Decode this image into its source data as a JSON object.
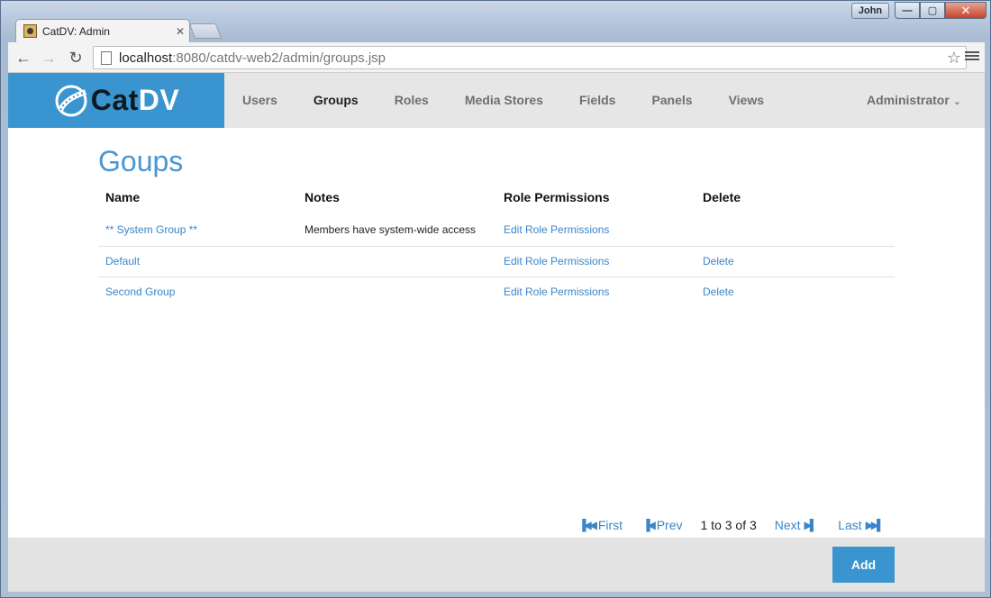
{
  "window": {
    "user": "John",
    "min_glyph": "—",
    "max_glyph": "▢",
    "close_glyph": "✕"
  },
  "tab": {
    "title": "CatDV: Admin",
    "close_glyph": "✕"
  },
  "toolbar": {
    "back_glyph": "←",
    "forward_glyph": "→",
    "reload_glyph": "↻",
    "url_host": "localhost",
    "url_path": ":8080/catdv-web2/admin/groups.jsp",
    "star_glyph": "☆"
  },
  "app": {
    "logo_cat": "Cat",
    "logo_dv": "DV",
    "nav": [
      {
        "label": "Users"
      },
      {
        "label": "Groups"
      },
      {
        "label": "Roles"
      },
      {
        "label": "Media Stores"
      },
      {
        "label": "Fields"
      },
      {
        "label": "Panels"
      },
      {
        "label": "Views"
      }
    ],
    "active_nav": "Groups",
    "admin_label": "Administrator",
    "admin_chevron": "⌄",
    "accent_color": "#3a94cf"
  },
  "page": {
    "title": "Goups",
    "columns": [
      "Name",
      "Notes",
      "Role Permissions",
      "Delete"
    ],
    "rows": [
      {
        "name": "** System Group **",
        "notes": "Members have system-wide access",
        "role": "Edit Role Permissions",
        "delete": ""
      },
      {
        "name": "Default",
        "notes": "",
        "role": "Edit Role Permissions",
        "delete": "Delete"
      },
      {
        "name": "Second Group",
        "notes": "",
        "role": "Edit Role Permissions",
        "delete": "Delete"
      }
    ],
    "pager": {
      "first": "First",
      "prev": "Prev",
      "status": "1 to 3 of 3",
      "next": "Next",
      "last": "Last"
    },
    "add_label": "Add"
  }
}
